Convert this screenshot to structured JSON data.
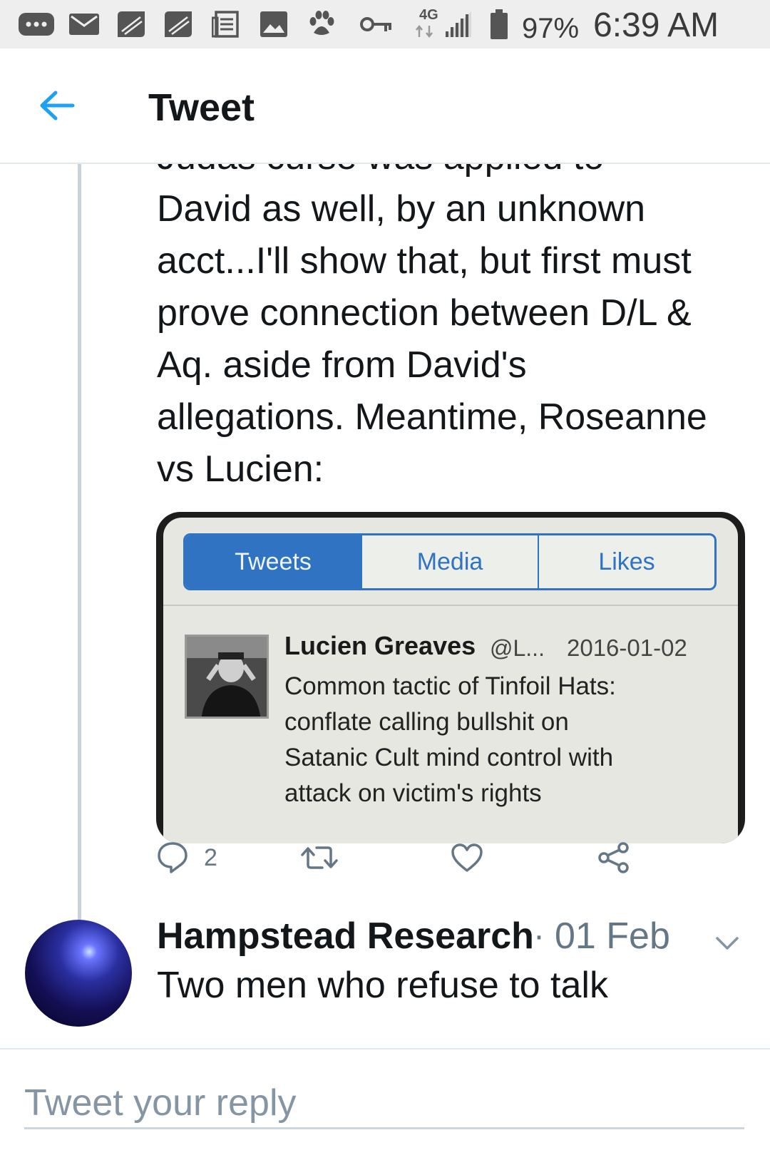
{
  "status_bar": {
    "icons": [
      "more-icon",
      "mail-icon",
      "blackberry-icon",
      "blackberry-icon",
      "news-icon",
      "image-icon",
      "paw-icon",
      "key-icon",
      "network-icon",
      "signal-icon",
      "battery-icon"
    ],
    "network": "4G",
    "battery": "97%",
    "time": "6:39 AM"
  },
  "header": {
    "title": "Tweet"
  },
  "tweet": {
    "text": "Judas curse was applied to\nDavid as well, by an unknown\nacct...I'll show that, but first must\nprove connection between D/L &\nAq. aside from David's\nallegations. Meantime, Roseanne\nvs Lucien:",
    "media": {
      "tabs": [
        "Tweets",
        "Media",
        "Likes"
      ],
      "active_tab": "Tweets",
      "embedded_tweet": {
        "name": "Lucien Greaves",
        "handle": "@L...",
        "date": "2016-01-02",
        "text": "Common tactic of Tinfoil Hats:\nconflate calling bullshit on\nSatanic Cult mind control with\nattack on victim's rights"
      }
    },
    "actions": {
      "reply_count": "2"
    }
  },
  "next_tweet": {
    "author": "Hampstead Research",
    "separator": "·",
    "date": "01 Feb",
    "text": "Two men who refuse to talk"
  },
  "reply": {
    "placeholder": "Tweet your reply"
  },
  "colors": {
    "accent": "#1da1f2",
    "secondary_text": "#657786",
    "segment_blue": "#2f73c2"
  }
}
